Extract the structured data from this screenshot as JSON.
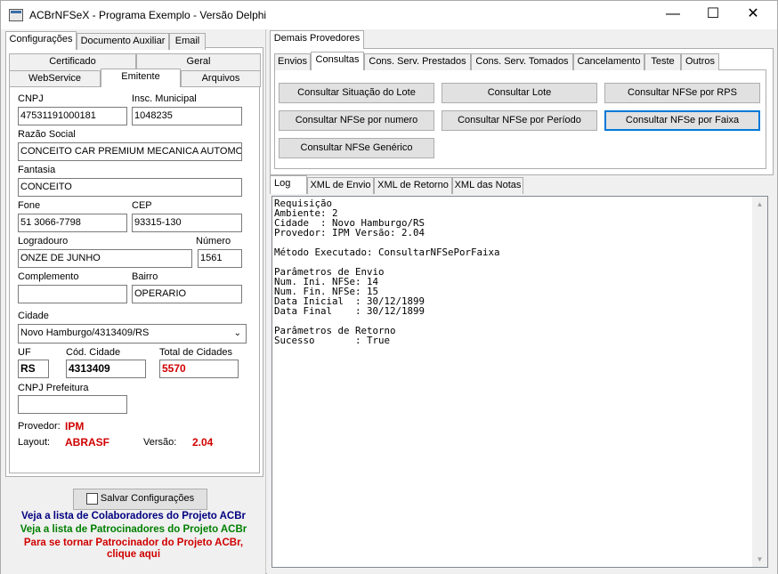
{
  "window": {
    "title": "ACBrNFSeX - Programa Exemplo - Versão Delphi",
    "minimize": "—",
    "maximize": "☐",
    "close": "✕"
  },
  "left": {
    "top_tabs": [
      "Configurações",
      "Documento Auxiliar",
      "Email"
    ],
    "sub_tabs_row1": [
      "Certificado",
      "Geral"
    ],
    "sub_tabs_row2": [
      "WebService",
      "Emitente",
      "Arquivos"
    ],
    "form": {
      "cnpj_label": "CNPJ",
      "cnpj_value": "47531191000181",
      "insc_municipal_label": "Insc. Municipal",
      "insc_municipal_value": "1048235",
      "razao_social_label": "Razão Social",
      "razao_social_value": "CONCEITO CAR PREMIUM MECANICA AUTOMOTIVA",
      "fantasia_label": "Fantasia",
      "fantasia_value": "CONCEITO",
      "fone_label": "Fone",
      "fone_value": "51 3066-7798",
      "cep_label": "CEP",
      "cep_value": "93315-130",
      "logradouro_label": "Logradouro",
      "logradouro_value": "ONZE DE JUNHO",
      "numero_label": "Número",
      "numero_value": "1561",
      "complemento_label": "Complemento",
      "complemento_value": "",
      "bairro_label": "Bairro",
      "bairro_value": "OPERARIO",
      "cidade_label": "Cidade",
      "cidade_value": "Novo Hamburgo/4313409/RS",
      "uf_label": "UF",
      "uf_value": "RS",
      "cod_cidade_label": "Cód. Cidade",
      "cod_cidade_value": "4313409",
      "total_cidades_label": "Total de Cidades",
      "total_cidades_value": "5570",
      "cnpj_prefeitura_label": "CNPJ Prefeitura",
      "cnpj_prefeitura_value": "",
      "provedor_label": "Provedor:",
      "provedor_value": "IPM",
      "layout_label": "Layout:",
      "layout_value": "ABRASF",
      "versao_label": "Versão:",
      "versao_value": "2.04"
    },
    "save_button": "Salvar Configurações",
    "links": {
      "colaboradores": "Veja a lista de Colaboradores do Projeto ACBr",
      "patrocinadores": "Veja a lista de Patrocinadores do Projeto ACBr",
      "tornar_1": "Para se tornar Patrocinador do Projeto ACBr,",
      "tornar_2": "clique aqui"
    }
  },
  "right": {
    "top_tab": "Demais Provedores",
    "tabs": [
      "Envios",
      "Consultas",
      "Cons. Serv. Prestados",
      "Cons. Serv. Tomados",
      "Cancelamento",
      "Teste",
      "Outros"
    ],
    "buttons": [
      "Consultar Situação do Lote",
      "Consultar Lote",
      "Consultar NFSe por RPS",
      "Consultar NFSe por numero",
      "Consultar NFSe por Período",
      "Consultar NFSe por Faixa",
      "Consultar NFSe Genérico"
    ],
    "log_tabs": [
      "Log",
      "XML de Envio",
      "XML de Retorno",
      "XML das Notas"
    ],
    "log_text": "Requisição\nAmbiente: 2\nCidade  : Novo Hamburgo/RS\nProvedor: IPM Versão: 2.04\n\nMétodo Executado: ConsultarNFSePorFaixa\n\nParâmetros de Envio\nNum. Ini. NFSe: 14\nNum. Fin. NFSe: 15\nData Inicial  : 30/12/1899\nData Final    : 30/12/1899\n\nParâmetros de Retorno\nSucesso       : True"
  },
  "colors": {
    "accent": "#0078d7",
    "red": "#d00000",
    "link_blue": "#000080",
    "link_green": "#008000"
  }
}
